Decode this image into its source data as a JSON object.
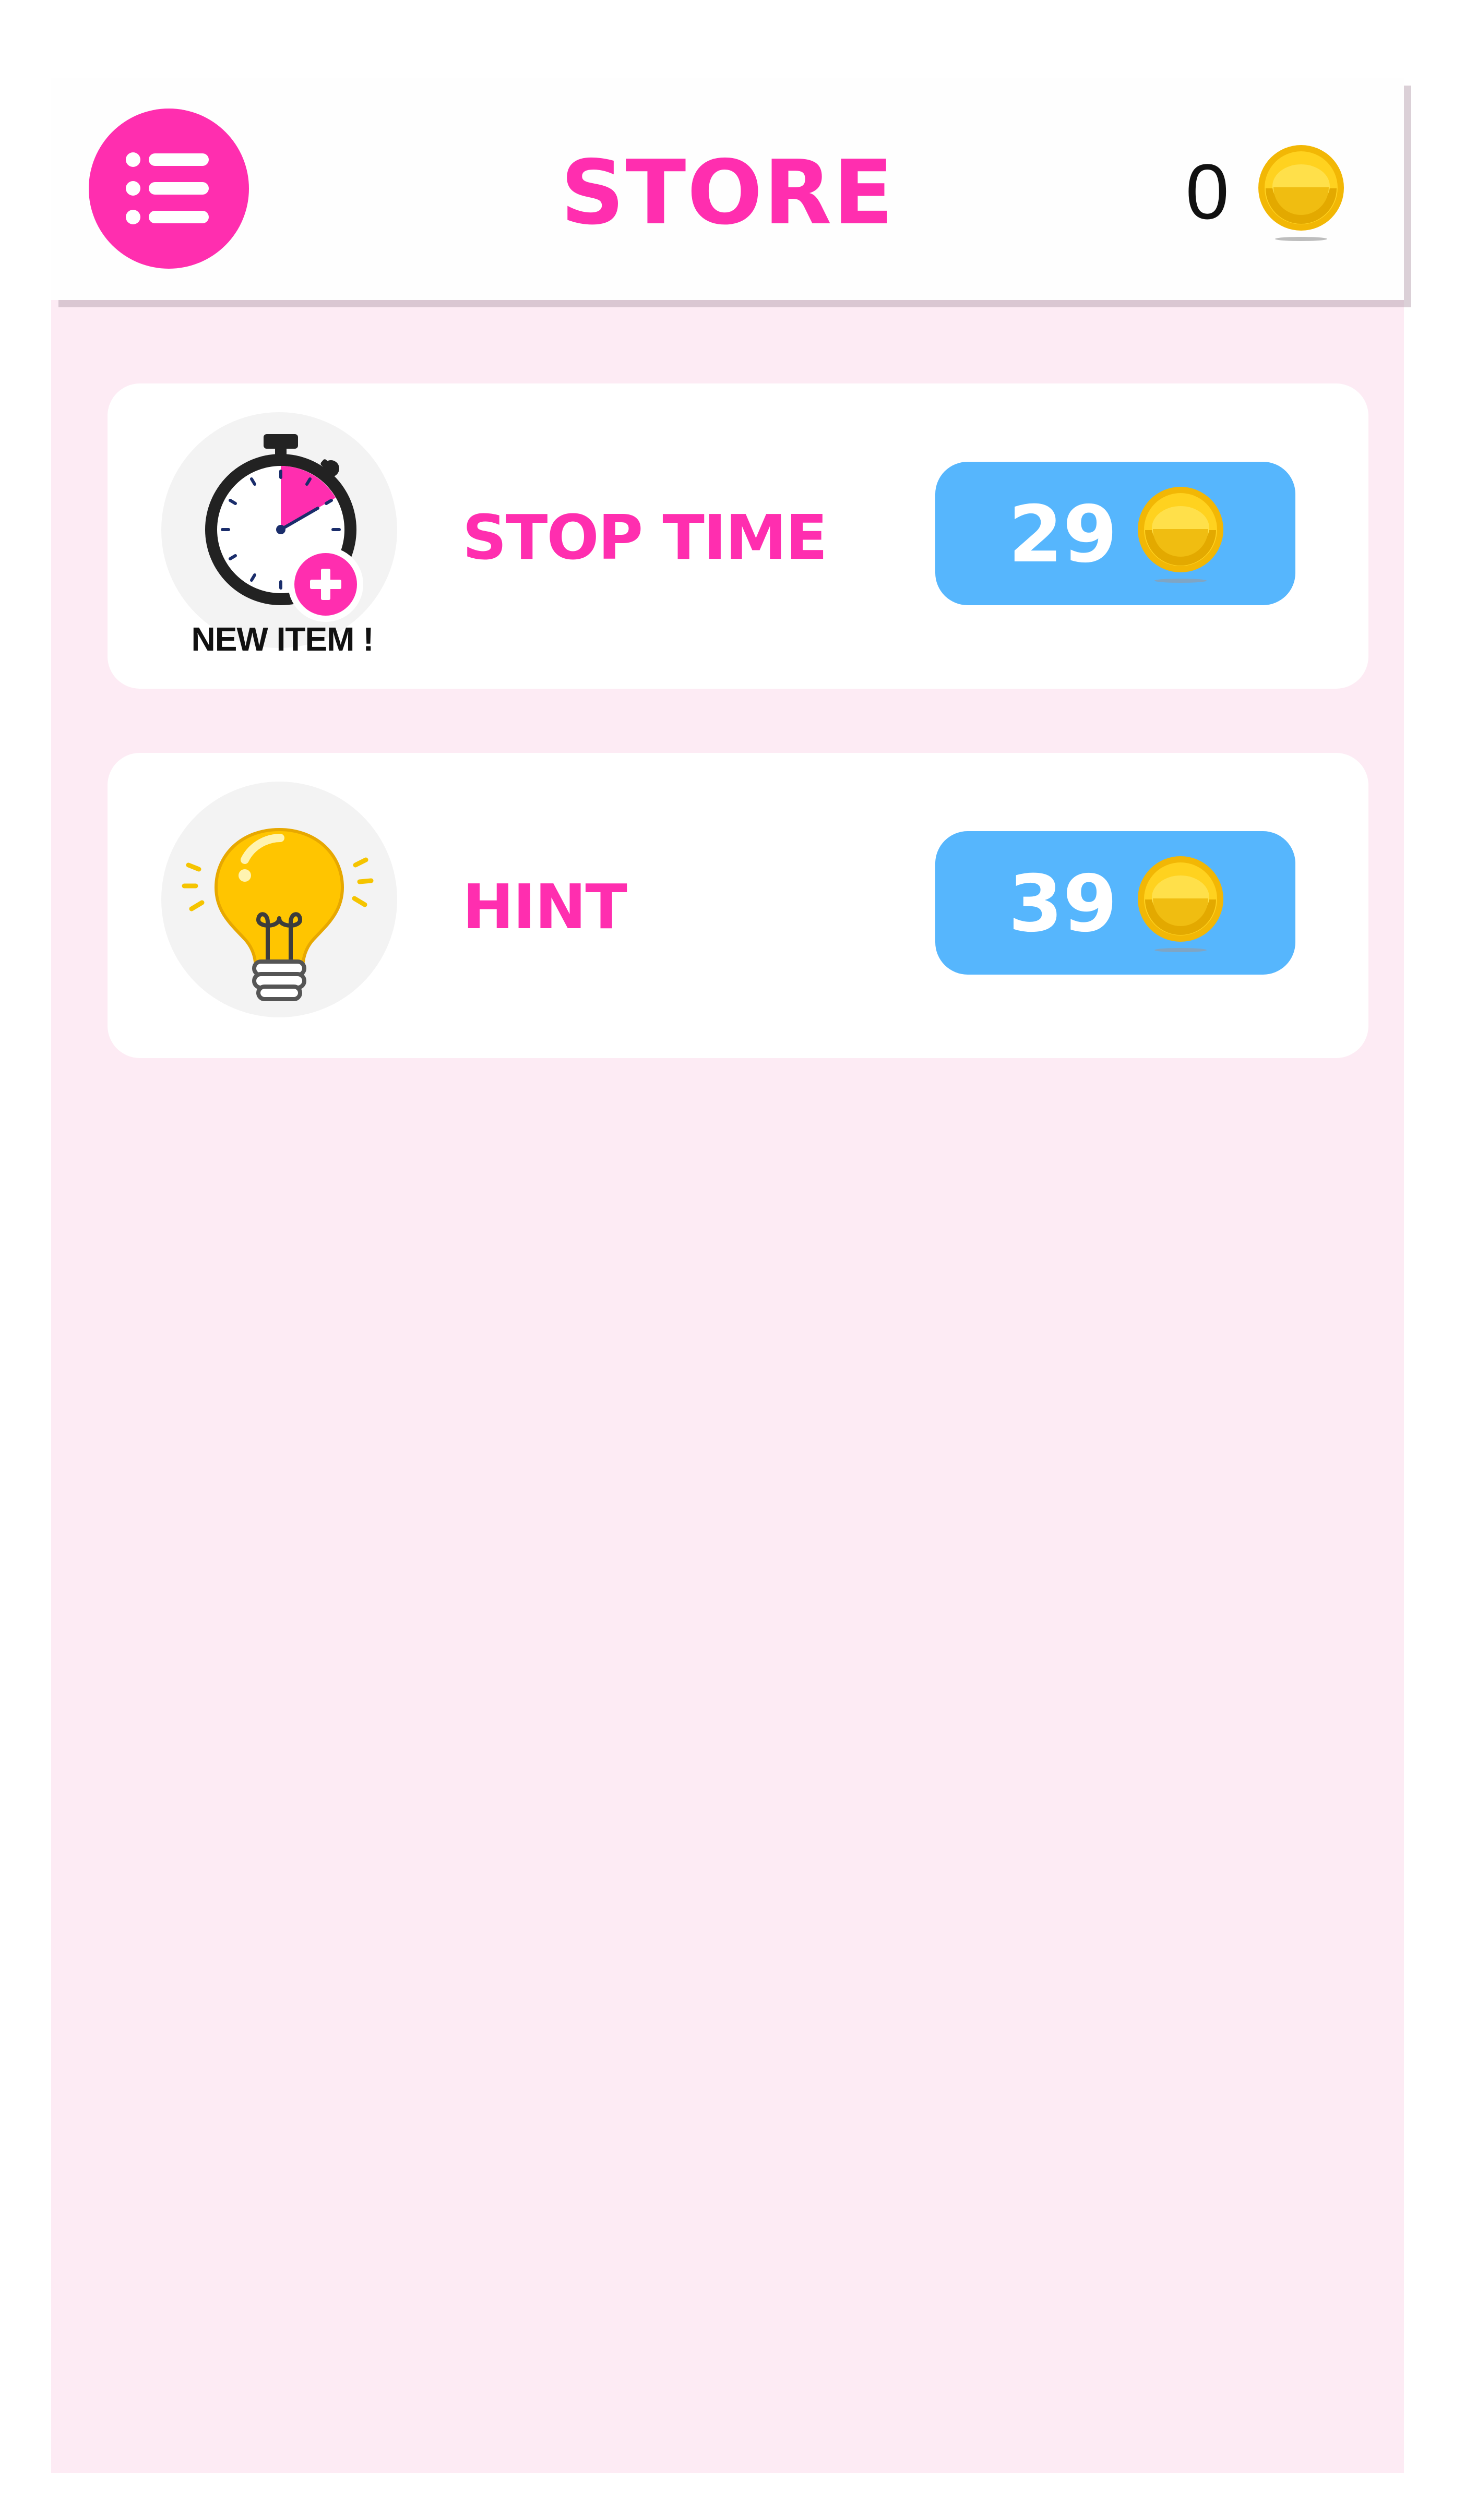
{
  "header": {
    "title": "STORE",
    "coin_balance": "0",
    "menu_icon": "list-menu-icon",
    "coin_icon": "gold-coin-icon"
  },
  "items": [
    {
      "name": "STOP TIME",
      "price": "29",
      "badge": "NEW ITEM !",
      "icon": "stopwatch-plus-icon"
    },
    {
      "name": "HINT",
      "price": "39",
      "icon": "lightbulb-icon"
    }
  ],
  "colors": {
    "accent_pink": "#ff2eaf",
    "price_blue": "#56b6fd",
    "background_pink": "#fdebf4",
    "coin_gold": "#f5c400"
  }
}
